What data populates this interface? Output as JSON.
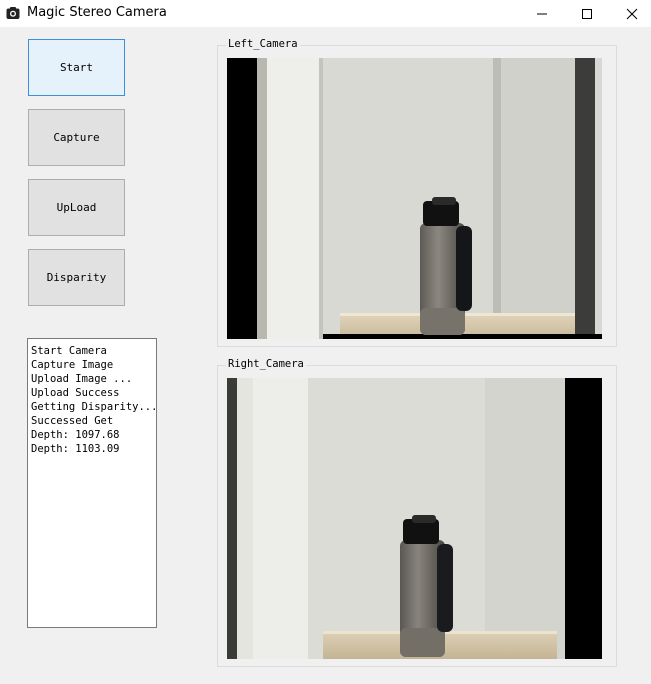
{
  "window": {
    "title": "Magic Stereo Camera",
    "icons": [
      "camera-icon",
      "minimize-icon",
      "maximize-icon",
      "close-icon"
    ]
  },
  "buttons": [
    {
      "label": "Start",
      "state": "focused"
    },
    {
      "label": "Capture"
    },
    {
      "label": "UpLoad"
    },
    {
      "label": "Disparity"
    }
  ],
  "log": [
    "Start Camera",
    "Capture Image",
    "Upload Image ...",
    "Upload Success",
    "Getting Disparity...",
    "Successed Get",
    "Depth: 1097.68",
    "Depth: 1103.09"
  ],
  "cameras": {
    "left_label": "Left_Camera",
    "right_label": "Right_Camera"
  },
  "colors": {
    "accent": "#3c8fd8",
    "background": "#f0f0f0"
  }
}
